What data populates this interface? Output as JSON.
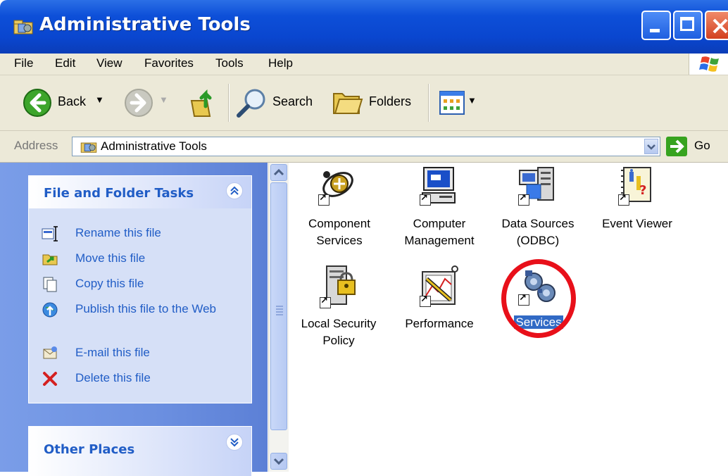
{
  "window": {
    "title": "Administrative Tools"
  },
  "menu": {
    "items": [
      "File",
      "Edit",
      "View",
      "Favorites",
      "Tools",
      "Help"
    ]
  },
  "toolbar": {
    "back_label": "Back",
    "search_label": "Search",
    "folders_label": "Folders"
  },
  "address": {
    "label": "Address",
    "value": "Administrative Tools",
    "go_label": "Go"
  },
  "tasks_panel": {
    "title": "File and Folder Tasks",
    "items": [
      {
        "label": "Rename this file",
        "icon": "rename-icon"
      },
      {
        "label": "Move this file",
        "icon": "move-icon"
      },
      {
        "label": "Copy this file",
        "icon": "copy-icon"
      },
      {
        "label": "Publish this file to the Web",
        "icon": "publish-web-icon"
      },
      {
        "label": "E-mail this file",
        "icon": "email-icon"
      },
      {
        "label": "Delete this file",
        "icon": "delete-icon"
      }
    ]
  },
  "other_panel": {
    "title": "Other Places"
  },
  "icons": [
    {
      "label": "Component Services",
      "line1": "Component",
      "line2": "Services"
    },
    {
      "label": "Computer Management",
      "line1": "Computer",
      "line2": "Management"
    },
    {
      "label": "Data Sources (ODBC)",
      "line1": "Data Sources",
      "line2": "(ODBC)"
    },
    {
      "label": "Event Viewer",
      "line1": "Event Viewer",
      "line2": ""
    },
    {
      "label": "Local Security Policy",
      "line1": "Local Security",
      "line2": "Policy"
    },
    {
      "label": "Performance",
      "line1": "Performance",
      "line2": ""
    },
    {
      "label": "Services",
      "line1": "Services",
      "line2": "",
      "selected": true
    }
  ],
  "colors": {
    "title_bar": "#0a46cf",
    "task_link": "#215dc6",
    "selection": "#316ac5",
    "highlight_ring": "#e8101a"
  }
}
